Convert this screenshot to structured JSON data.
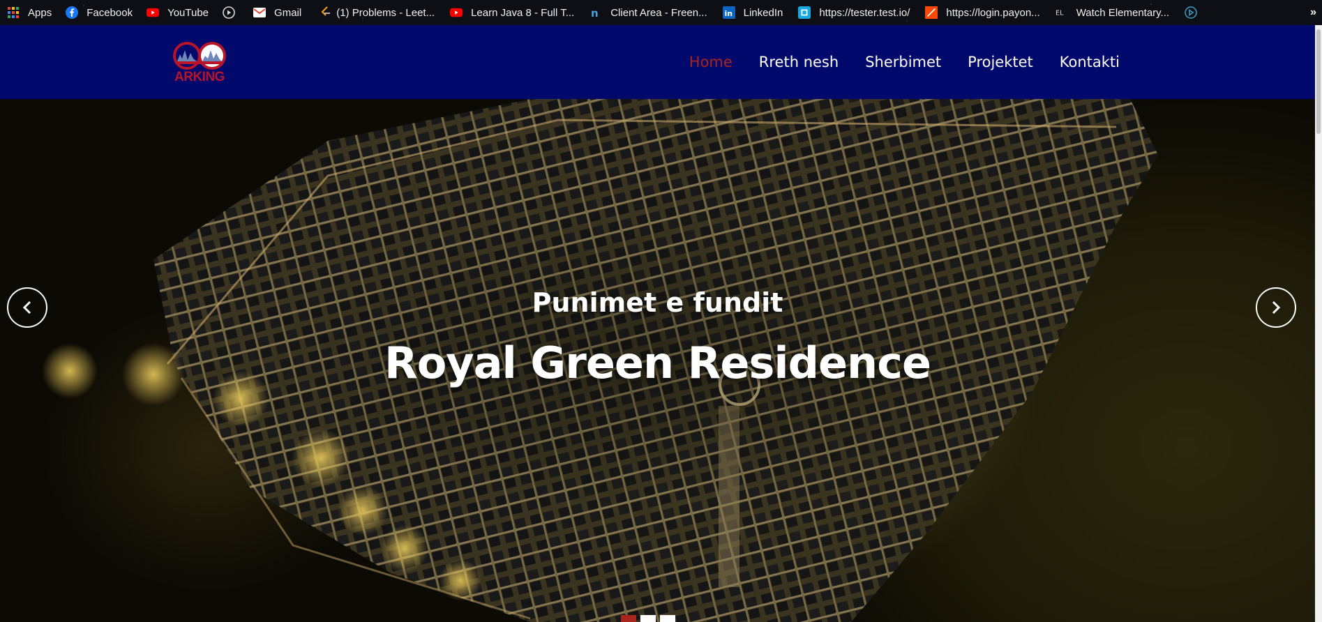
{
  "bookmarks": [
    {
      "label": "Apps",
      "icon": "apps-grid-icon"
    },
    {
      "label": "Facebook",
      "icon": "facebook-icon"
    },
    {
      "label": "YouTube",
      "icon": "youtube-icon"
    },
    {
      "label": "",
      "icon": "play-circle-icon"
    },
    {
      "label": "Gmail",
      "icon": "gmail-icon"
    },
    {
      "label": "(1) Problems - Leet...",
      "icon": "leetcode-icon"
    },
    {
      "label": "Learn Java 8 - Full T...",
      "icon": "youtube-icon"
    },
    {
      "label": "Client Area - Freen...",
      "icon": "freenom-icon"
    },
    {
      "label": "LinkedIn",
      "icon": "linkedin-icon"
    },
    {
      "label": "https://tester.test.io/",
      "icon": "testio-icon"
    },
    {
      "label": "https://login.payon...",
      "icon": "payoneer-icon"
    },
    {
      "label": "Watch Elementary...",
      "icon": "el-icon"
    },
    {
      "label": "",
      "icon": "play-outline-icon"
    }
  ],
  "bookmarks_more": "»",
  "site": {
    "logo_text": "ARKING",
    "nav": [
      {
        "label": "Home",
        "active": true
      },
      {
        "label": "Rreth nesh",
        "active": false
      },
      {
        "label": "Sherbimet",
        "active": false
      },
      {
        "label": "Projektet",
        "active": false
      },
      {
        "label": "Kontakti",
        "active": false
      }
    ],
    "accent_color": "#a8251e",
    "header_color": "#010a6c"
  },
  "hero": {
    "subtitle": "Punimet e fundit",
    "title": "Royal Green Residence",
    "slide_count": 3,
    "active_slide": 1
  }
}
